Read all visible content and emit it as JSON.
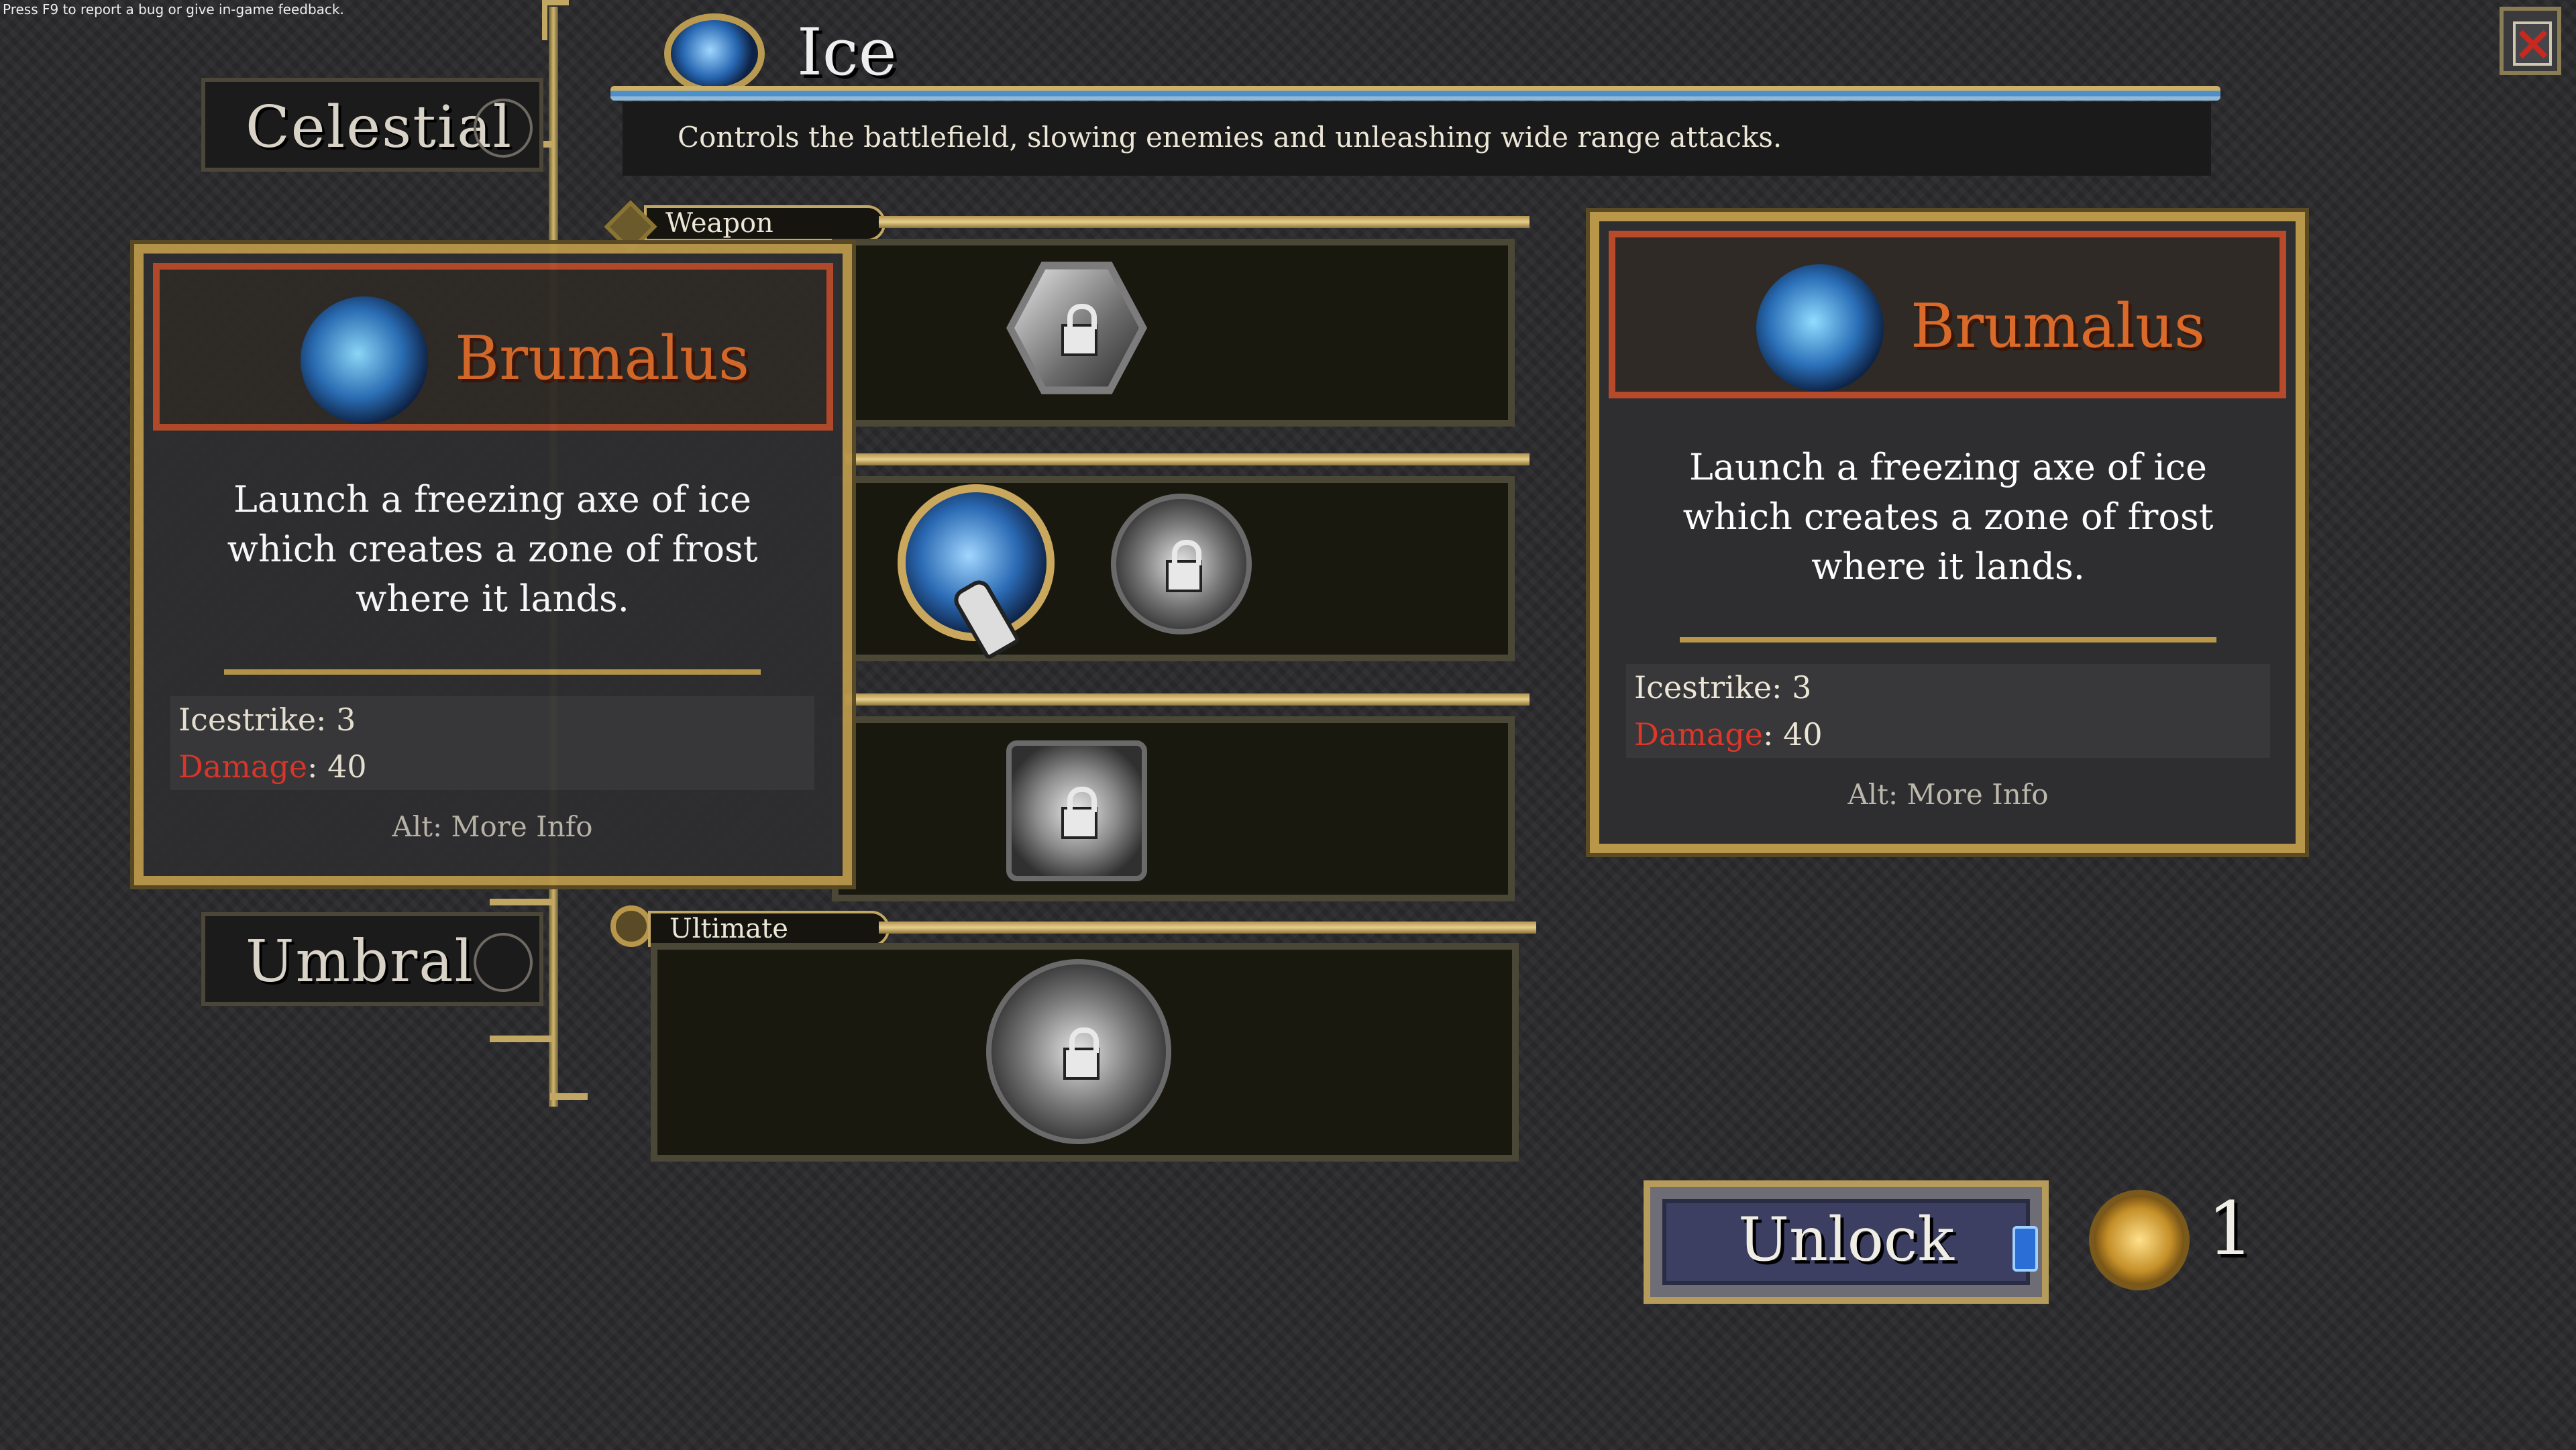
{
  "feedback_hint": "Press F9 to report a bug or give in-game feedback.",
  "close_icon": "close-icon",
  "categories": {
    "celestial": "Celestial",
    "umbral": "Umbral"
  },
  "header": {
    "title": "Ice",
    "description": "Controls the battlefield, slowing enemies and unleashing wide range attacks."
  },
  "sections": {
    "weapon": "Weapon",
    "ultimate": "Ultimate"
  },
  "tooltip_left": {
    "name": "Brumalus",
    "description": "Launch a freezing axe of ice which creates a zone of frost where it lands.",
    "stat1_label": "Icestrike",
    "stat1_value": "3",
    "stat2_label": "Damage",
    "stat2_value": "40",
    "more_info": "Alt: More Info"
  },
  "tooltip_right": {
    "name": "Brumalus",
    "description": "Launch a freezing axe of ice which creates a zone of frost where it lands.",
    "stat1_label": "Icestrike",
    "stat1_value": "3",
    "stat2_label": "Damage",
    "stat2_value": "40",
    "more_info": "Alt: More Info"
  },
  "unlock": {
    "label": "Unlock",
    "currency_count": "1"
  },
  "colors": {
    "accent_gold": "#b8974b",
    "item_name": "#d96a2a",
    "damage_red": "#e0362a",
    "ice_blue": "#2a6fb8"
  }
}
